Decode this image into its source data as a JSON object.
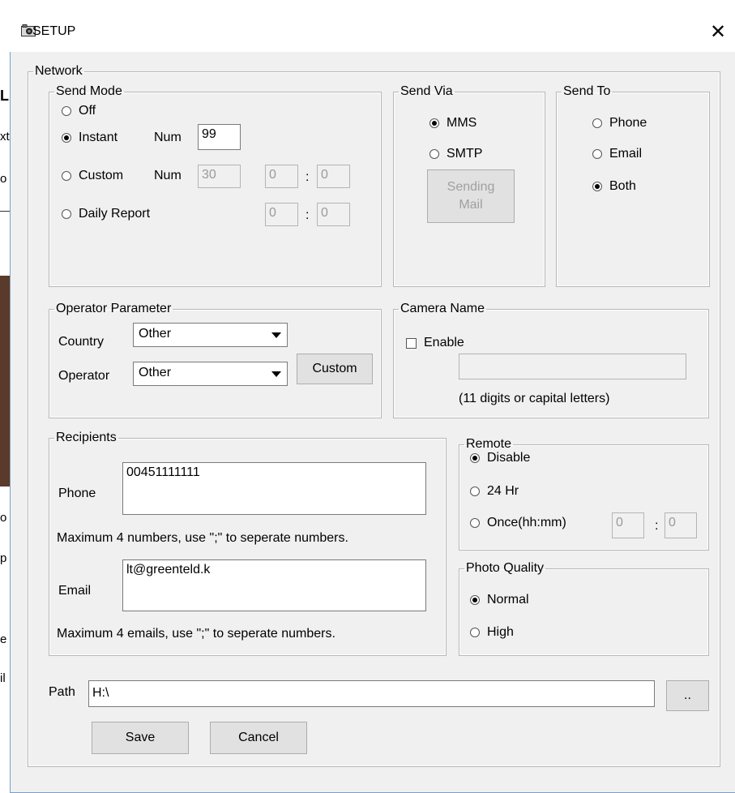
{
  "window": {
    "title": "SETUP",
    "close_glyph": "✕"
  },
  "background_fragments": [
    "L",
    "xt",
    "o",
    "o",
    "p",
    "e",
    "il"
  ],
  "network": {
    "legend": "Network",
    "send_mode": {
      "legend": "Send Mode",
      "off": "Off",
      "instant": "Instant",
      "instant_num_label": "Num",
      "instant_num_value": "99",
      "custom": "Custom",
      "custom_num_label": "Num",
      "custom_num_value": "30",
      "custom_hh": "0",
      "custom_mm": "0",
      "daily_report": "Daily Report",
      "daily_hh": "0",
      "daily_mm": "0",
      "colon": ":"
    },
    "send_via": {
      "legend": "Send Via",
      "mms": "MMS",
      "smtp": "SMTP",
      "sending_mail_line1": "Sending",
      "sending_mail_line2": "Mail"
    },
    "send_to": {
      "legend": "Send To",
      "phone": "Phone",
      "email": "Email",
      "both": "Both"
    },
    "operator_parameter": {
      "legend": "Operator Parameter",
      "country_label": "Country",
      "country_value": "Other",
      "operator_label": "Operator",
      "operator_value": "Other",
      "custom_button": "Custom"
    },
    "camera_name": {
      "legend": "Camera Name",
      "enable_label": "Enable",
      "name_value": "",
      "hint": "(11 digits or capital letters)"
    },
    "recipients": {
      "legend": "Recipients",
      "phone_label": "Phone",
      "phone_value": "00451111111",
      "phone_hint": "Maximum 4 numbers, use \";\" to seperate numbers.",
      "email_label": "Email",
      "email_value": "lt@greenteld.k",
      "email_hint": "Maximum 4 emails, use \";\" to seperate numbers."
    },
    "remote": {
      "legend": "Remote",
      "disable": "Disable",
      "hr24": "24 Hr",
      "once": "Once(hh:mm)",
      "once_hh": "0",
      "once_mm": "0",
      "colon": ":"
    },
    "photo_quality": {
      "legend": "Photo Quality",
      "normal": "Normal",
      "high": "High"
    },
    "path": {
      "label": "Path",
      "value": "H:\\",
      "browse_button": ".."
    }
  },
  "buttons": {
    "save": "Save",
    "cancel": "Cancel"
  },
  "colors": {
    "window_bg": "#f0f0f0",
    "button_bg": "#e1e1e1",
    "border": "#b7b7b7"
  }
}
